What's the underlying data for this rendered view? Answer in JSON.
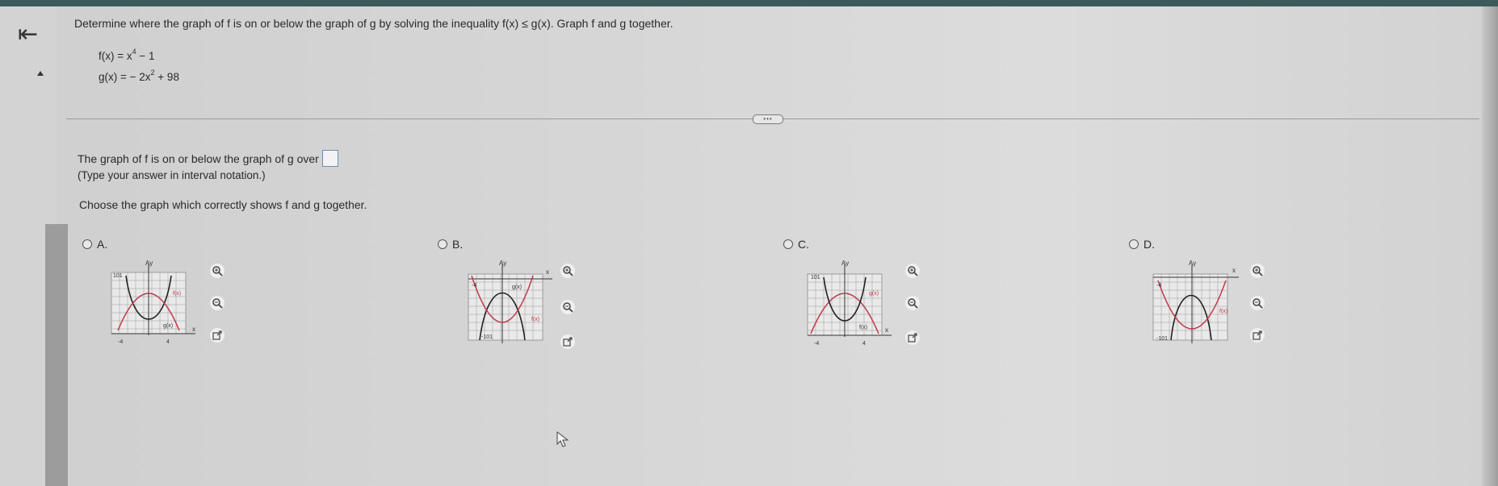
{
  "nav": {
    "back_icon": "back-to-start-icon",
    "up_icon": "caret-up-icon"
  },
  "question": {
    "prompt": "Determine where the graph of f is on or below the graph of g by solving the inequality f(x) ≤ g(x). Graph f and g together.",
    "f_left": "f(x) = x",
    "f_exp": "4",
    "f_right": " − 1",
    "g_left": "g(x) = − 2x",
    "g_exp": "2",
    "g_right": " + 98"
  },
  "divider": {
    "button_label": "•••"
  },
  "answer": {
    "statement": "The graph of f is on or below the graph of g over",
    "hint": "(Type your answer in interval notation.)",
    "input_value": ""
  },
  "choose_text": "Choose the graph which correctly shows f and g together.",
  "options": [
    {
      "label": "A.",
      "labels": {
        "y": "Ay",
        "x": "x",
        "top": "101",
        "f": "f(x)",
        "g": "g(x)",
        "xl": "-4",
        "xr": "4"
      }
    },
    {
      "label": "B.",
      "labels": {
        "y": "Ay",
        "x": "x",
        "top": "-4",
        "f": "f(x)",
        "g": "g(x)",
        "bottom": "-101"
      }
    },
    {
      "label": "C.",
      "labels": {
        "y": "Ay",
        "x": "x",
        "top": "101",
        "f": "f(x)",
        "g": "g(x)",
        "xl": "-4",
        "xr": "4"
      }
    },
    {
      "label": "D.",
      "labels": {
        "y": "Ay",
        "x": "x",
        "top": "-4",
        "f": "f(x)",
        "bottom": "-101"
      }
    }
  ],
  "tools": [
    "zoom-in-icon",
    "zoom-out-icon",
    "open-external-icon"
  ],
  "colors": {
    "topbar": "#3c5a5c",
    "f_curve": "#c0394b",
    "g_curve": "#a84a5a",
    "grid": "#8a8a8a"
  }
}
